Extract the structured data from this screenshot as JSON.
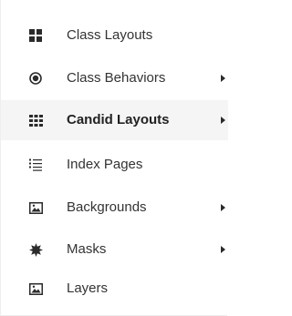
{
  "menu": {
    "items": [
      {
        "label": "Class Layouts",
        "icon": "grid-2x2-icon",
        "has_submenu": false,
        "active": false
      },
      {
        "label": "Class Behaviors",
        "icon": "target-icon",
        "has_submenu": true,
        "active": false
      },
      {
        "label": "Candid Layouts",
        "icon": "grid-3x3-icon",
        "has_submenu": true,
        "active": true
      },
      {
        "label": "Index Pages",
        "icon": "list-numbered-icon",
        "has_submenu": false,
        "active": false
      },
      {
        "label": "Backgrounds",
        "icon": "image-icon",
        "has_submenu": true,
        "active": false
      },
      {
        "label": "Masks",
        "icon": "starburst-icon",
        "has_submenu": true,
        "active": false
      },
      {
        "label": "Layers",
        "icon": "image-icon",
        "has_submenu": false,
        "active": false
      }
    ]
  },
  "colors": {
    "text": "#333333",
    "icon": "#2b2b2b",
    "active_background": "#f5f5f5",
    "border": "#eeeeee"
  }
}
